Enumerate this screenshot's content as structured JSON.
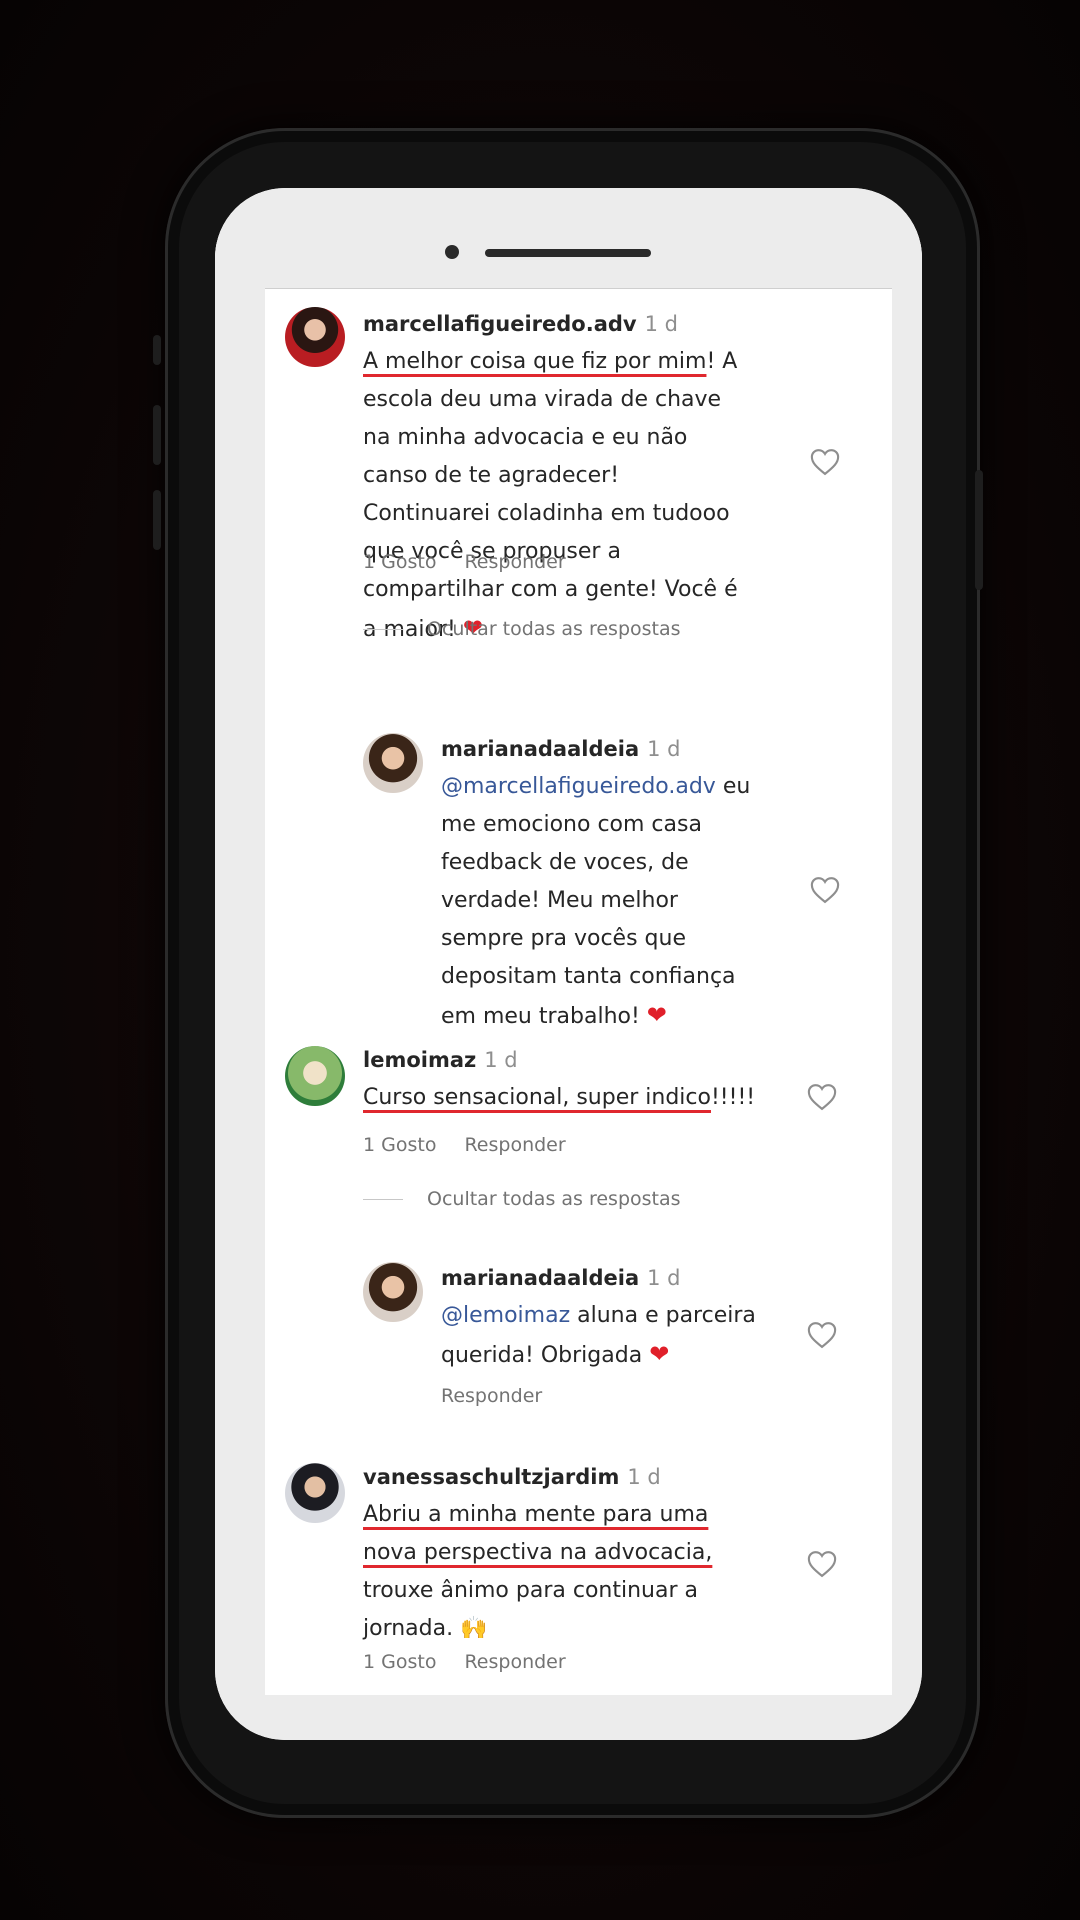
{
  "comments": [
    {
      "username": "marcellafigueiredo.adv",
      "time": "1 d",
      "text_underlined": "A melhor coisa que fiz por mim",
      "text_rest": "! A escola deu uma virada de chave na minha advocacia e eu não canso de te agradecer! Continuarei coladinha em tudooo que você se propuser a compartilhar com a gente! Você é a maior! ",
      "emoji": "❤",
      "likes": "1 Gosto",
      "reply_label": "Responder",
      "hide_replies": "Ocultar todas as respostas"
    },
    {
      "username": "lemoimaz",
      "time": "1 d",
      "text_underlined": "Curso sensacional, super indico",
      "text_rest": "!!!!!",
      "likes": "1 Gosto",
      "reply_label": "Responder",
      "hide_replies": "Ocultar todas as respostas"
    },
    {
      "username": "vanessaschultzjardim",
      "time": "1 d",
      "text_underlined_1": "Abriu a minha mente para uma",
      "text_underlined_2": "nova perspectiva na advocacia,",
      "text_rest": "trouxe ânimo para continuar a jornada. ",
      "emoji": "🙌",
      "likes": "1 Gosto",
      "reply_label": "Responder"
    }
  ],
  "replies": [
    {
      "username": "marianadaaldeia",
      "time": "1 d",
      "mention": "@marcellafigueiredo.adv",
      "text": " eu me emociono com casa feedback de voces, de verdade! Meu melhor sempre pra vocês que depositam tanta confiança em meu trabalho! ",
      "emoji": "❤"
    },
    {
      "username": "marianadaaldeia",
      "time": "1 d",
      "mention": "@lemoimaz",
      "text": " aluna e parceira querida! Obrigada ",
      "emoji": "❤",
      "reply_label": "Responder"
    }
  ]
}
